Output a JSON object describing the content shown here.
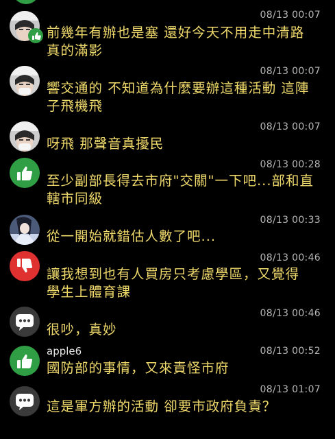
{
  "comments": [
    {
      "avatar": "profile-photo-with-thumbs-up-badge",
      "username": "",
      "timestamp": "08/13 00:07",
      "lines": [
        "前幾年有辦也是塞 還好今天不用走中清路",
        "真的滿影"
      ]
    },
    {
      "avatar": "profile-photo",
      "username": "",
      "timestamp": "08/13 00:07",
      "lines": [
        "響交通的 不知道為什麼要辦這種活動 這陣",
        "子飛機飛"
      ]
    },
    {
      "avatar": "profile-photo",
      "username": "",
      "timestamp": "08/13 00:07",
      "lines": [
        "呀飛 那聲音真擾民"
      ]
    },
    {
      "avatar": "thumbs-up-icon",
      "username": "",
      "timestamp": "08/13 00:28",
      "lines": [
        "至少副部長得去市府\"交關\"一下吧...部和直",
        "轄市同級"
      ]
    },
    {
      "avatar": "anime-character-avatar",
      "username": "",
      "timestamp": "08/13 00:33",
      "lines": [
        "從一開始就錯估人數了吧..."
      ]
    },
    {
      "avatar": "thumbs-down-icon",
      "username": "",
      "timestamp": "08/13 00:46",
      "lines": [
        "讓我想到也有人買房只考慮學區，又覺得",
        "學生上體育課"
      ]
    },
    {
      "avatar": "chat-bubble-icon",
      "username": "",
      "timestamp": "08/13 00:46",
      "lines": [
        "很吵，真妙"
      ]
    },
    {
      "avatar": "thumbs-up-icon",
      "username": "apple6",
      "timestamp": "08/13 00:52",
      "lines": [
        "國防部的事情，又來責怪市府"
      ]
    },
    {
      "avatar": "chat-bubble-icon",
      "username": "",
      "timestamp": "08/13 01:07",
      "lines": [
        "這是軍方辦的活動 卻要市政府負責？"
      ]
    }
  ],
  "colors": {
    "background": "#000000",
    "comment_text": "#f0d96b",
    "timestamp": "#b8b8b8",
    "username": "#e6e6e6",
    "like_green": "#2f9e44",
    "dislike_red": "#e03131",
    "neutral_gray": "#3a3a3a"
  }
}
